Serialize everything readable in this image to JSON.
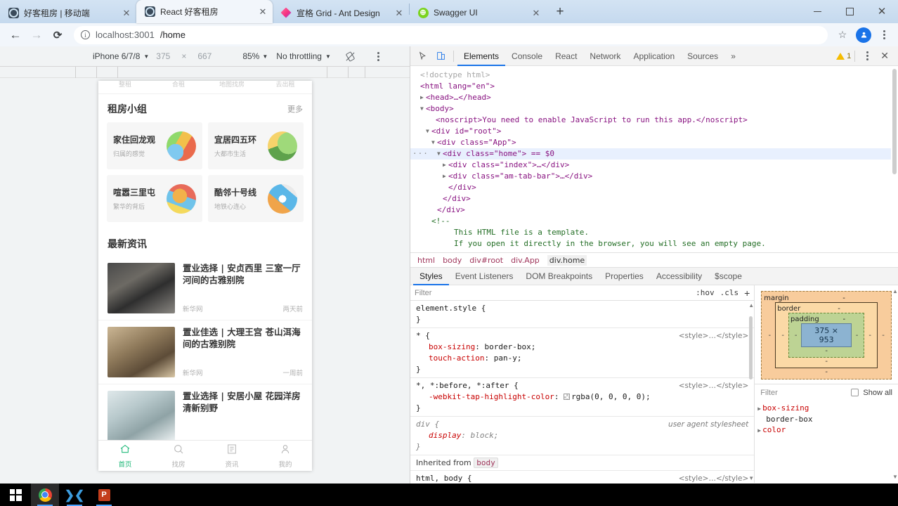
{
  "browser": {
    "tabs": [
      {
        "title": "好客租房 | 移动端",
        "favicon": "hk-icon",
        "active": false
      },
      {
        "title": "React 好客租房",
        "favicon": "hk-icon",
        "active": true
      },
      {
        "title": "宣格 Grid - Ant Design",
        "favicon": "antd-icon",
        "active": false
      },
      {
        "title": "Swagger UI",
        "favicon": "swagger-icon",
        "active": false
      }
    ],
    "new_tab_label": "+",
    "close_label": "✕",
    "window_controls": {
      "minimize": "–",
      "maximize": "❐",
      "close": "✕"
    },
    "toolbar": {
      "back": "←",
      "forward": "→",
      "reload": "⟳",
      "url_host": "localhost:3001",
      "url_path": "/home",
      "info_icon": "ⓘ",
      "star": "☆",
      "avatar_letter": "⬤",
      "menu": "⋮"
    }
  },
  "device_toolbar": {
    "device": "iPhone 6/7/8",
    "width": "375",
    "x_label": "×",
    "height": "667",
    "zoom": "85%",
    "throttling": "No throttling",
    "rotate_icon": "⬭",
    "menu": "⋮",
    "caret": "▼"
  },
  "mobile_page": {
    "nav_categories": [
      "整租",
      "合租",
      "地图找房",
      "去出租"
    ],
    "group_section": {
      "title": "租房小组",
      "more": "更多",
      "cards": [
        {
          "title": "家住回龙观",
          "subtitle": "归属的感觉",
          "img": "group-img-1"
        },
        {
          "title": "宜居四五环",
          "subtitle": "大都市生活",
          "img": "group-img-2"
        },
        {
          "title": "喧嚣三里屯",
          "subtitle": "繁华的背后",
          "img": "group-img-3"
        },
        {
          "title": "酷邻十号线",
          "subtitle": "地铁心连心",
          "img": "group-img-4"
        }
      ]
    },
    "news_section": {
      "title": "最新资讯",
      "items": [
        {
          "title": "置业选择 | 安贞西里 三室一厅 河间的古雅别院",
          "source": "新华网",
          "time": "两天前",
          "thumb": "news-thumb-1"
        },
        {
          "title": "置业佳选 | 大理王宫 苍山洱海 间的古雅别院",
          "source": "新华网",
          "time": "一周前",
          "thumb": "news-thumb-2"
        },
        {
          "title": "置业选择 | 安居小屋 花园洋房 清新别野",
          "source": "",
          "time": "",
          "thumb": "news-thumb-3"
        }
      ]
    },
    "tabbar": [
      {
        "label": "首页",
        "icon": "home-icon",
        "glyph": "⌂",
        "selected": true
      },
      {
        "label": "找房",
        "icon": "search-icon",
        "glyph": "◎",
        "selected": false
      },
      {
        "label": "资讯",
        "icon": "news-icon",
        "glyph": "▤",
        "selected": false
      },
      {
        "label": "我的",
        "icon": "user-icon",
        "glyph": "⛉",
        "selected": false
      }
    ]
  },
  "devtools": {
    "toolbar": {
      "inspect_icon": "⬚",
      "device_icon": "▯",
      "tabs": [
        "Elements",
        "Console",
        "React",
        "Network",
        "Application",
        "Sources"
      ],
      "active_tab": "Elements",
      "overflow": "»",
      "warning_count": "1",
      "menu": "⋮",
      "close": "✕"
    },
    "dom_lines": [
      {
        "indent": 1,
        "marker": "",
        "content": "<!doctype html>",
        "kind": "doctype"
      },
      {
        "indent": 1,
        "marker": "",
        "content": "<html lang=\"en\">",
        "kind": "tag"
      },
      {
        "indent": 1,
        "marker": "▶",
        "content": "<head>…</head>",
        "kind": "tag"
      },
      {
        "indent": 1,
        "marker": "▼",
        "content": "<body>",
        "kind": "tag"
      },
      {
        "indent": 2,
        "marker": "",
        "content": "<noscript>You need to enable JavaScript to run this app.</noscript>",
        "kind": "tag"
      },
      {
        "indent": 2,
        "marker": "▼",
        "content": "<div id=\"root\">",
        "kind": "tag"
      },
      {
        "indent": 3,
        "marker": "▼",
        "content": "<div class=\"App\">",
        "kind": "tag"
      },
      {
        "indent": 4,
        "marker": "▼",
        "content": "<div class=\"home\"> == $0",
        "kind": "selected"
      },
      {
        "indent": 5,
        "marker": "▶",
        "content": "<div class=\"index\">…</div>",
        "kind": "tag"
      },
      {
        "indent": 5,
        "marker": "▶",
        "content": "<div class=\"am-tab-bar\">…</div>",
        "kind": "tag"
      },
      {
        "indent": 5,
        "marker": "",
        "content": "</div>",
        "kind": "tag"
      },
      {
        "indent": 4,
        "marker": "",
        "content": "</div>",
        "kind": "tag"
      },
      {
        "indent": 3,
        "marker": "",
        "content": "</div>",
        "kind": "tag"
      },
      {
        "indent": 2,
        "marker": "",
        "content": "<!--",
        "kind": "comment"
      },
      {
        "indent": 4,
        "marker": "",
        "content": "This HTML file is a template.",
        "kind": "comment"
      },
      {
        "indent": 4,
        "marker": "",
        "content": "If you open it directly in the browser, you will see an empty page.",
        "kind": "comment"
      }
    ],
    "breadcrumb": [
      "html",
      "body",
      "div#root",
      "div.App",
      "div.home"
    ],
    "sidebar_tabs": [
      "Styles",
      "Event Listeners",
      "DOM Breakpoints",
      "Properties",
      "Accessibility",
      "$scope"
    ],
    "sidebar_active_tab": "Styles",
    "styles": {
      "filter_placeholder": "Filter",
      "hov_label": ":hov",
      "cls_label": ".cls",
      "plus_label": "+",
      "rules": [
        {
          "selector": "element.style {",
          "source": "",
          "decls": [],
          "close": "}"
        },
        {
          "selector": "* {",
          "source": "<style>…</style>",
          "decls": [
            {
              "prop": "box-sizing",
              "value": "border-box;"
            },
            {
              "prop": "touch-action",
              "value": "pan-y;"
            }
          ],
          "close": "}"
        },
        {
          "selector": "*, *:before, *:after {",
          "source": "<style>…</style>",
          "decls": [
            {
              "prop": "-webkit-tap-highlight-color",
              "value": "rgba(0, 0, 0, 0);",
              "swatch": true
            }
          ],
          "close": "}"
        },
        {
          "selector": "div {",
          "source": "user agent stylesheet",
          "ua": true,
          "decls": [
            {
              "prop": "display",
              "value": "block;"
            }
          ],
          "close": "}"
        }
      ],
      "inherited_label": "Inherited from",
      "inherited_node": "body",
      "inherited_rule": {
        "selector": "html, body {",
        "source": "<style>…</style>"
      }
    },
    "box_model": {
      "margin_label": "margin",
      "border_label": "border",
      "padding_label": "padding",
      "content_size": "375 × 953",
      "dash": "-"
    },
    "computed": {
      "filter_placeholder": "Filter",
      "show_all_label": "Show all",
      "properties": [
        {
          "name": "box-sizing",
          "value": "border-box"
        },
        {
          "name": "color",
          "value": ""
        }
      ]
    }
  },
  "taskbar": {
    "items": [
      {
        "name": "start-button",
        "icon": "windows-logo"
      },
      {
        "name": "chrome-taskbar-button",
        "icon": "chrome-logo",
        "active": true
      },
      {
        "name": "vscode-taskbar-button",
        "icon": "vscode-logo"
      },
      {
        "name": "powerpoint-taskbar-button",
        "icon": "powerpoint-logo"
      }
    ]
  }
}
